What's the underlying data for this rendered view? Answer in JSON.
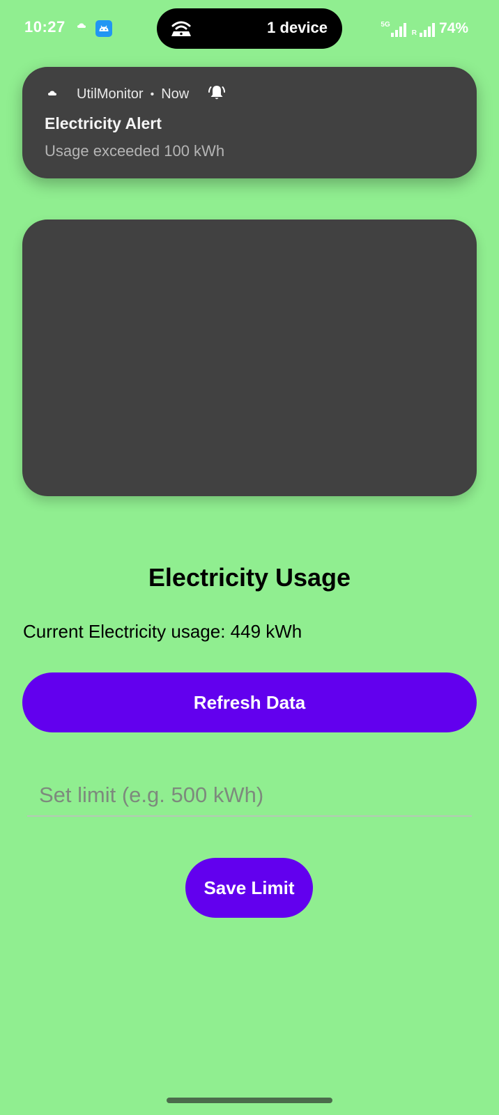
{
  "status_bar": {
    "time": "10:27",
    "hotspot_label": "1 device",
    "network_type": "5G",
    "roaming_indicator": "R",
    "battery": "74%",
    "icons": [
      "cloud-icon",
      "android-app-icon",
      "hotspot-icon",
      "signal-icon",
      "signal-icon",
      "battery"
    ]
  },
  "notification": {
    "app_name": "UtilMonitor",
    "separator": "•",
    "time": "Now",
    "title": "Electricity Alert",
    "body": "Usage exceeded 100 kWh",
    "icons": [
      "cloud-icon",
      "bell-alert-icon"
    ]
  },
  "main": {
    "title": "Electricity Usage",
    "usage_text": "Current Electricity usage: 449 kWh",
    "refresh_label": "Refresh Data",
    "limit_placeholder": "Set limit (e.g. 500 kWh)",
    "limit_value": "",
    "save_label": "Save Limit"
  },
  "colors": {
    "background": "#90EE90",
    "accent": "#6200EE",
    "card": "#414141"
  }
}
